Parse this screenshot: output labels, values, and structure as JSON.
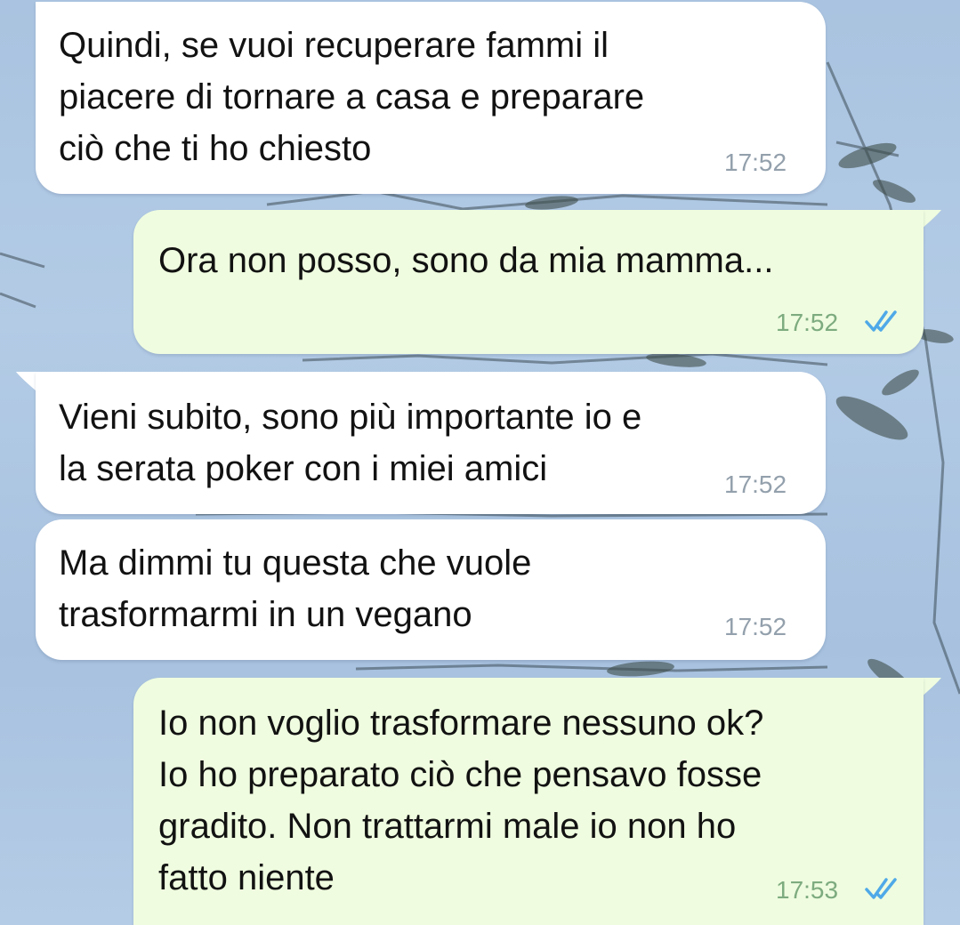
{
  "chat": {
    "messages": [
      {
        "direction": "incoming",
        "text": "Quindi, se vuoi recuperare fammi il\npiacere di tornare a casa e preparare\nciò che ti ho chiesto",
        "time": "17:52"
      },
      {
        "direction": "outgoing",
        "text": "Ora non posso, sono da mia mamma...",
        "time": "17:52",
        "status_icon": "double-check-icon"
      },
      {
        "direction": "incoming",
        "text": "Vieni subito, sono più importante io e\nla serata poker con i miei amici",
        "time": "17:52"
      },
      {
        "direction": "incoming",
        "text": "Ma dimmi tu questa che vuole\ntrasformarmi in un vegano",
        "time": "17:52"
      },
      {
        "direction": "outgoing",
        "text": "Io non voglio trasformare nessuno ok?\nIo ho preparato ciò che pensavo fosse\ngradito. Non trattarmi male io non ho\nfatto niente",
        "time": "17:53",
        "status_icon": "double-check-icon"
      }
    ]
  },
  "colors": {
    "incoming_bubble": "#ffffff",
    "outgoing_bubble": "#effcdf",
    "read_check": "#4fa9e8",
    "wallpaper": "#adc6e2"
  }
}
